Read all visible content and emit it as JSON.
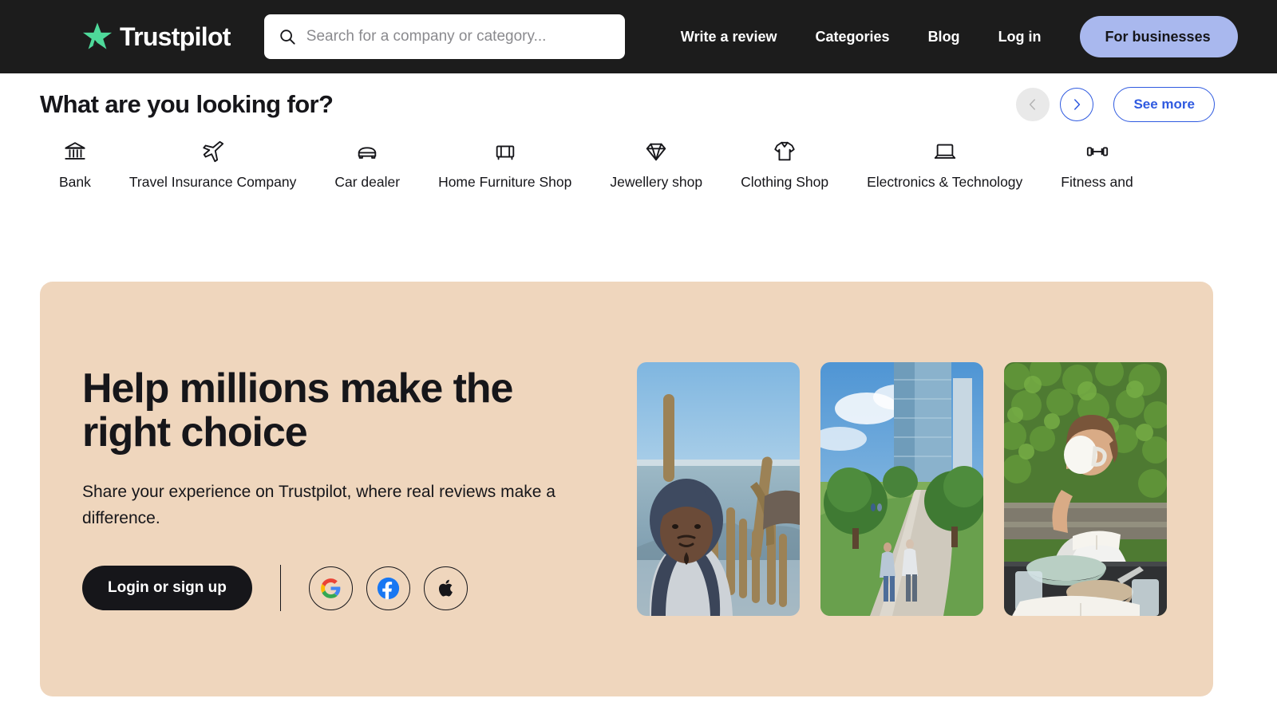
{
  "header": {
    "logo_text": "Trustpilot",
    "logo_icon": "trustpilot-star-icon",
    "search": {
      "icon": "search-icon",
      "placeholder": "Search for a company or category...",
      "value": ""
    },
    "nav_links": [
      {
        "label": "Write a review"
      },
      {
        "label": "Categories"
      },
      {
        "label": "Blog"
      },
      {
        "label": "Log in"
      }
    ],
    "cta_label": "For businesses",
    "background_color": "#1c1c1c",
    "cta_color": "#a9b8ee",
    "star_color": "#4ed99a"
  },
  "categories": {
    "title": "What are you looking for?",
    "prev_label": "Previous",
    "next_label": "Next",
    "see_more_label": "See more",
    "accent_color": "#2f5ae0",
    "items": [
      {
        "label": "Bank",
        "icon": "bank-icon"
      },
      {
        "label": "Travel Insurance Company",
        "icon": "airplane-icon"
      },
      {
        "label": "Car dealer",
        "icon": "car-icon"
      },
      {
        "label": "Home Furniture Shop",
        "icon": "armchair-icon"
      },
      {
        "label": "Jewellery shop",
        "icon": "diamond-icon"
      },
      {
        "label": "Clothing Shop",
        "icon": "tshirt-icon"
      },
      {
        "label": "Electronics & Technology",
        "icon": "laptop-icon"
      },
      {
        "label": "Fitness and",
        "icon": "dumbbell-icon"
      }
    ]
  },
  "hero": {
    "title": "Help millions make the right choice",
    "subtitle": "Share your experience on Trustpilot, where real reviews make a difference.",
    "login_label": "Login or sign up",
    "background_color": "#efd6bd",
    "social_buttons": [
      {
        "name": "google",
        "icon": "google-icon"
      },
      {
        "name": "facebook",
        "icon": "facebook-icon"
      },
      {
        "name": "apple",
        "icon": "apple-icon"
      }
    ],
    "photos": [
      {
        "alt": "Man in a hooded sweatshirt taking a selfie beside tall cacti with the ocean behind"
      },
      {
        "alt": "Two people walking along a park path with trees and a glass office tower"
      },
      {
        "alt": "Young person in a white t-shirt drinking from a mug at an outdoor table with bowls and a book"
      }
    ]
  }
}
